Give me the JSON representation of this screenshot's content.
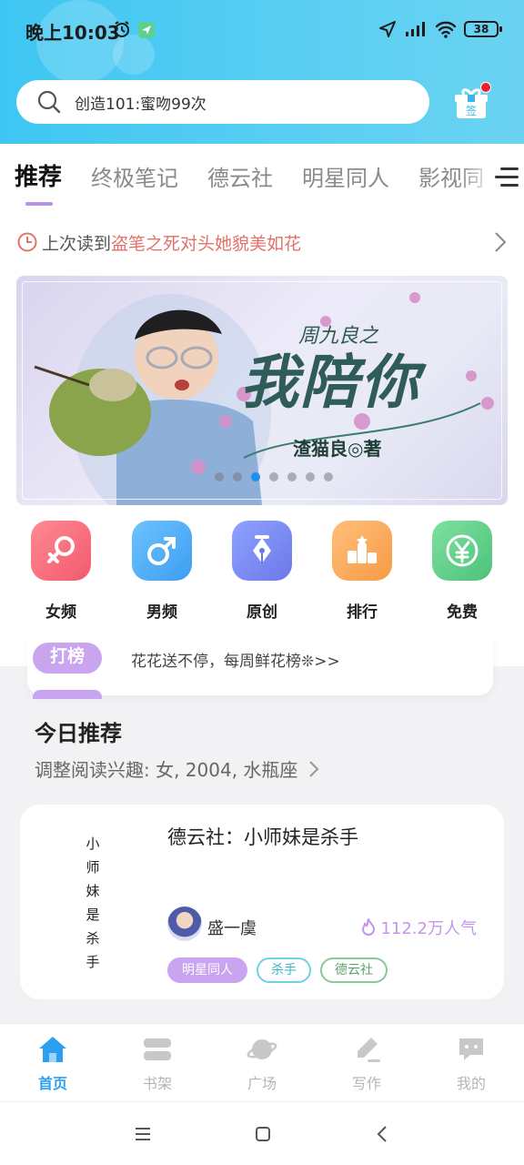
{
  "status_bar": {
    "time": "晚上10:03",
    "battery": "38"
  },
  "search": {
    "placeholder": "创造101:蜜吻99次"
  },
  "checkin": {
    "label": "签"
  },
  "tabs": [
    {
      "label": "推荐",
      "active": true
    },
    {
      "label": "终极笔记",
      "active": false
    },
    {
      "label": "德云社",
      "active": false
    },
    {
      "label": "明星同人",
      "active": false
    },
    {
      "label": "影视同",
      "active": false
    }
  ],
  "last_read": {
    "label": "上次读到",
    "book": "盗笔之死对头她貌美如花"
  },
  "banner": {
    "subtitle": "周九良之",
    "title": "我陪你",
    "author": "渣猫良◎著",
    "dot_count": 7,
    "active_dot": 2
  },
  "categories": [
    {
      "label": "女频",
      "icon": "female-icon",
      "color": "#f56f7d"
    },
    {
      "label": "男频",
      "icon": "male-icon",
      "color": "#43a8f4"
    },
    {
      "label": "原创",
      "icon": "pen-nib-icon",
      "color": "#7c8cf0"
    },
    {
      "label": "排行",
      "icon": "ranking-icon",
      "color": "#f7a24c"
    },
    {
      "label": "免费",
      "icon": "yen-icon",
      "color": "#5ccc7f"
    }
  ],
  "notice": {
    "tag": "打榜",
    "text": "花花送不停，每周鲜花榜❊>>"
  },
  "today": {
    "title": "今日推荐",
    "subtitle": "调整阅读兴趣: 女, 2004, 水瓶座"
  },
  "book_card": {
    "cover_chars": [
      "小",
      "师",
      "妹",
      "是",
      "杀",
      "手"
    ],
    "title": "德云社：小师妹是杀手",
    "author": "盛一虞",
    "popularity": "112.2万人气",
    "tags": [
      "明星同人",
      "杀手",
      "德云社"
    ]
  },
  "bottom_nav": [
    {
      "label": "首页",
      "icon": "home-icon",
      "active": true
    },
    {
      "label": "书架",
      "icon": "bookshelf-icon",
      "active": false
    },
    {
      "label": "广场",
      "icon": "planet-icon",
      "active": false
    },
    {
      "label": "写作",
      "icon": "write-icon",
      "active": false
    },
    {
      "label": "我的",
      "icon": "profile-icon",
      "active": false
    }
  ],
  "colors": {
    "header": "#52ccf3",
    "accent_purple": "#c9a4ef",
    "active_blue": "#2c9ff0",
    "last_read_book": "#e4716a"
  }
}
